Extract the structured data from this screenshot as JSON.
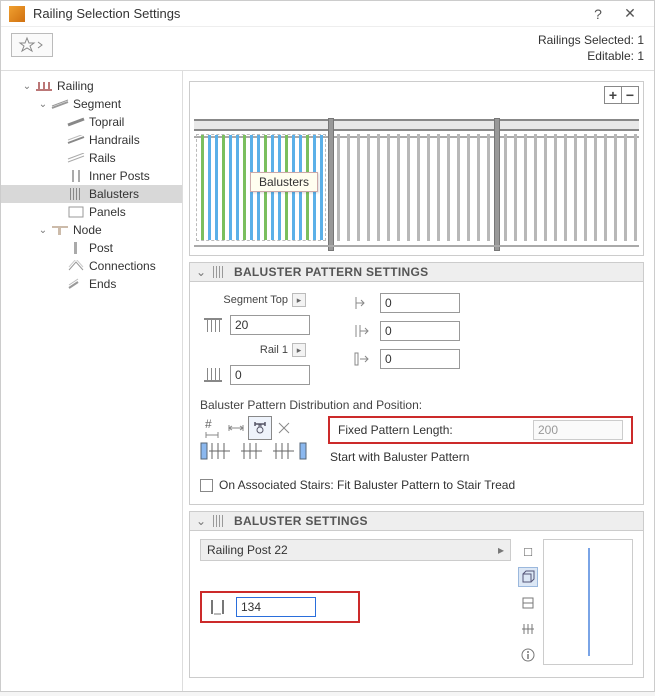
{
  "window": {
    "title": "Railing Selection Settings"
  },
  "status": {
    "line1": "Railings Selected: 1",
    "line2": "Editable: 1"
  },
  "tree": {
    "root": "Railing",
    "seg": "Segment",
    "seg_items": [
      "Toprail",
      "Handrails",
      "Rails",
      "Inner Posts",
      "Balusters",
      "Panels"
    ],
    "node": "Node",
    "node_items": [
      "Post",
      "Connections",
      "Ends"
    ]
  },
  "preview": {
    "tag": "Balusters",
    "zoom_in": "+",
    "zoom_out": "−"
  },
  "pattern": {
    "header": "BALUSTER PATTERN SETTINGS",
    "seg_top_label": "Segment Top",
    "seg_top_value": "20",
    "rail1_label": "Rail 1",
    "rail1_value": "0",
    "rc1": "0",
    "rc2": "0",
    "rc3": "0",
    "dist_label": "Baluster Pattern Distribution and Position:",
    "fpl_label": "Fixed Pattern Length:",
    "fpl_value": "200",
    "start_label": "Start with Baluster Pattern",
    "fit_label": "On Associated Stairs: Fit Baluster Pattern to Stair Tread"
  },
  "bsettings": {
    "header": "BALUSTER SETTINGS",
    "profile": "Railing Post 22",
    "offset": "134"
  }
}
